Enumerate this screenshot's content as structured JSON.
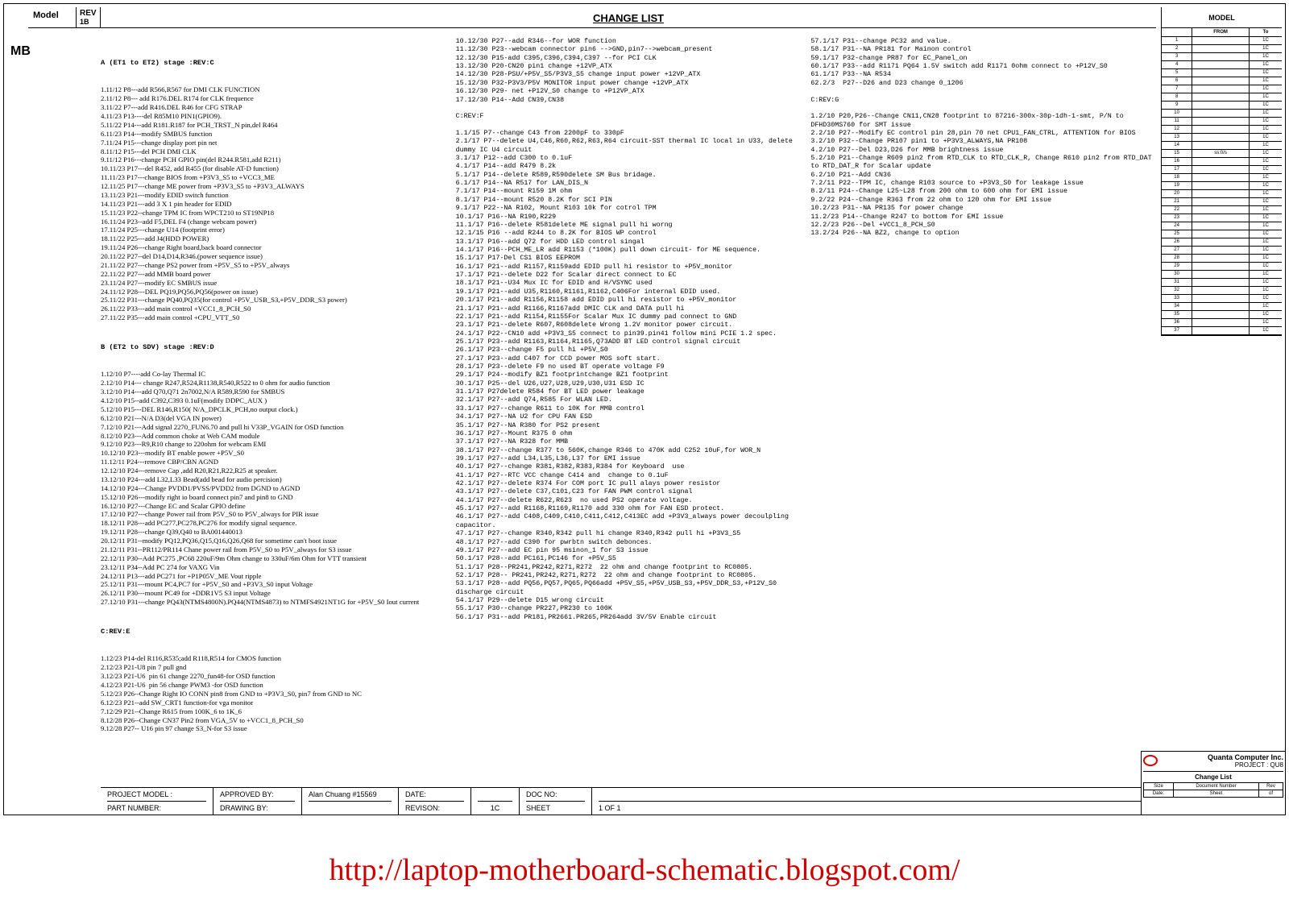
{
  "header": {
    "model_label": "Model",
    "rev_label": "REV",
    "rev_value": "1B",
    "change_list": "CHANGE LIST",
    "mb": "MB",
    "right_model": "MODEL"
  },
  "right_table": {
    "from": "FROM",
    "to": "To",
    "rows": [
      [
        "1",
        "",
        "1C"
      ],
      [
        "2",
        "",
        "1C"
      ],
      [
        "3",
        "",
        "1C"
      ],
      [
        "4",
        "",
        "1C"
      ],
      [
        "5",
        "",
        "1C"
      ],
      [
        "6",
        "",
        "1C"
      ],
      [
        "7",
        "",
        "1C"
      ],
      [
        "8",
        "",
        "1C"
      ],
      [
        "9",
        "",
        "1C"
      ],
      [
        "10",
        "",
        "1C"
      ],
      [
        "11",
        "",
        "1C"
      ],
      [
        "12",
        "",
        "1C"
      ],
      [
        "13",
        "",
        "1C"
      ],
      [
        "14",
        "",
        "1C"
      ],
      [
        "15",
        "ss:0/s",
        "1C"
      ],
      [
        "16",
        "",
        "1C"
      ],
      [
        "17",
        "",
        "1C"
      ],
      [
        "18",
        "",
        "1C"
      ],
      [
        "19",
        "",
        "1C"
      ],
      [
        "20",
        "",
        "1C"
      ],
      [
        "21",
        "",
        "1C"
      ],
      [
        "22",
        "",
        "1C"
      ],
      [
        "23",
        "",
        "1C"
      ],
      [
        "24",
        "",
        "1C"
      ],
      [
        "25",
        "",
        "1C"
      ],
      [
        "26",
        "",
        "1C"
      ],
      [
        "27",
        "",
        "1C"
      ],
      [
        "28",
        "",
        "1C"
      ],
      [
        "29",
        "",
        "1C"
      ],
      [
        "30",
        "",
        "1C"
      ],
      [
        "31",
        "",
        "1C"
      ],
      [
        "32",
        "",
        "1C"
      ],
      [
        "33",
        "",
        "1C"
      ],
      [
        "34",
        "",
        "1C"
      ],
      [
        "35",
        "",
        "1C"
      ],
      [
        "36",
        "",
        "1C"
      ],
      [
        "37",
        "",
        "1C"
      ]
    ]
  },
  "col1": {
    "heading_a": "A (ET1 to ET2) stage :REV:C",
    "lines_a": "1.11/12 P8---add R566,R567 for DMI CLK FUNCTION\n2.11/12 P8--- add R176.DEL R174 for CLK frequence\n3.11/22 P7---add R416.DEL R46 for CFG STRAP\n4.11/23 P13----del R85M10 PIN1(GPIO9).\n5.11/22 P14---add R181.R187 for PCH_TRST_N pin,del R464\n6.11/23 P14---modify SMBUS function\n7.11/24 P15---change display port pin net\n8.11/12 P15---del PCH DMI CLK\n9.11/12 P16---change PCH GPIO pin(del R244.R581,add R211)\n10.11/23 P17---del R452, add R455 (for disable AT-D function)\n11.11/23 P17---change BIOS from +P3V3_S5 to +VCC3_ME\n12.11/25 P17---change ME power from +P3V3_S5 to +P3V3_ALWAYS\n13.11/23 P21---modify EDID switch function\n14.11/23 P21---add 3 X 1 pin header for EDID\n15.11/23 P22--change TPM IC from WPCT210 to ST19NP18\n16.11/24 P23--add F5,DEL F4 (change webcam power)\n17.11/24 P25---change U14 (footprint error)\n18.11/22 P25---add J4(HDD POWER)\n19.11/24 P26---change Right board,back board connector\n20.11/22 P27--del D14,D14,R346.(power sequence issue)\n21.11/22 P27---change PS2 power from +P5V_S5 to +P5V_always\n22.11/22 P27---add MMB board power\n23.11/24 P27---modify EC SMBUS issue\n24.11/12 P28---DEL PQ19,PQ56,PQ56(power on issue)\n25.11/22 P31---change PQ40,PQ35(for control +P5V_USB_S3,+P5V_DDR_S3 power)\n26.11/22 P33---add main control +VCC1_8_PCH_S0\n27.11/22 P35---add main control +CPU_VTT_S0",
    "heading_b": "B (ET2 to SDV) stage :REV:D",
    "lines_b": "1.12/10 P7----add Co-lay Thermal IC\n2.12/10 P14--- change R247,R524,R1138,R540,R522 to 0 ohm for audio function\n3.12/10 P14---add Q70,Q71 2n7002,N/A R589,R590 for SMBUS\n4.12/10 P15--add C392,C393 0.1uF(modify DDPC_AUX )\n5.12/10 P15---DEL R146,R150( N/A_DPCLK_PCH,no output clock.)\n6.12/10 P21---N/A D3(del VGA IN power)\n7.12/10 P21---Add signal 2270_FUN6.70 and pull hi V33P_VGAIN for OSD function\n8.12/10 P23---Add common choke at Web CAM module\n9.12/10 P23---R9,R10 change to 220ohm for webcam EMI\n10.12/10 P23---modify BT enable power +P5V_S0\n11.12/11 P24---remove CBP/CBN AGND\n12.12/10 P24---remove Cap ,add R20,R21,R22,R25 at speaker.\n13.12/10 P24---add L32,L33 Bead(add bead for audio percision)\n14.12/10 P24---Change PVDD1/PVSS/PVDD2 from DGND to AGND\n15.12/10 P26---modify right io board connect pin7 and pin8 to GND\n16.12/10 P27---Change EC and Scalar GPIO define\n17.12/10 P27---change Power rail from P5V_S0 to P5V_always for PIR issue\n18.12/11 P28---add PC277,PC278,PC276 for modify signal sequence.\n19.12/11 P28---change Q39,Q40 to BA001440013\n20.12/11 P31--modify PQ12,PQ36,Q15,Q16,Q26,Q68 for sometime can't boot issue\n21.12/11 P31--PR112/PR114 Chane power rail from P5V_S0 to P5V_always for S3 issue\n22.12/11 P30--Add PC275 ,PC68 220uF/9m Ohm change to 330uF/6m Ohm for VTT transient\n23.12/11 P34--Add PC 274 for VAXG Vin\n24.12/11 P13---add PC271 for +P1P05V_ME Vout ripple\n25.12/11 P31---mount PC4,PC7 for +P5V_S0 and +P3V3_S0 input Voltage\n26.12/11 P30---mount PC49 for +DDR1V5 S3 input Voltage\n27.12/10 P31---change PQ43(NTMS4800N).PQ44(NTMS4873) to NTMFS4921NT1G for +P5V_S0 Iout current",
    "heading_c": "C:REV:E",
    "lines_c": "1.12/23 P14-del R116,R535;add R118,R514 for CMOS function\n2.12/23 P21-U8 pin 7 pull gnd\n3.12/23 P21-U6  pin 61 change 2270_fun48-for OSD function\n4.12/23 P21-U6  pin 56 change PWM3 -for OSD function\n5.12/23 P26--Change Right IO CONN pin8 from GND to +P3V3_S0, pin7 from GND to NC\n6.12/23 P21--add SW_CRT1 function-for vga monitor\n7.12/29 P21--Change R615 from 100K_6 to 1K_6\n8.12/28 P26--Change CN37 Pin2 from VGA_5V to +VCC1_8_PCH_S0\n9.12/28 P27-- U16 pin 97 change S3_N-for S3 issue"
  },
  "col2": "10.12/30 P27--add R346--for WOR function\n11.12/30 P23--webcam connector pin6 -->GND,pin7-->webcam_present\n12.12/30 P15-add C395,C396,C394,C397 --for PCI CLK\n13.12/30 P20-CN20 pin1 change +12VP_ATX\n14.12/30 P28-PSU/+P5V_S5/P3V3_S5 change input power +12VP_ATX\n15.12/30 P32-P3V3/P5V MONITOR input power change +12VP_ATX\n16.12/30 P29- net +P12V_S0 change to +P12VP_ATX\n17.12/30 P14--Add CN39,CN38\n\nC:REV:F\n\n1.1/15 P7--change C43 from 2200pF to 330pF\n2.1/17 P7--delete U4,C46,R60,R62,R63,R64 circuit-SST thermal IC local in U33, delete dummy IC U4 circuit\n3.1/17 P12--add C300 to 0.1uF\n4.1/17 P14--add R479 8.2k\n5.1/17 P14--delete R589,R590delete SM Bus bridage.\n6.1/17 P14--NA R517 for LAN_DIS_N\n7.1/17 P14--mount R159 1M ohm\n8.1/17 P14--mount R520 8.2K for SCI PIN\n9.1/17 P22--NA R102, Mount R103 10k for cotrol TPM\n10.1/17 P16--NA R190,R229\n11.1/17 P16--delete R581delete ME signal pull hi worng\n12.1/15 P16 --add R244 to 8.2K for BIOS WP control\n13.1/17 P16--add Q72 for HDD LED control singal\n14.1/17 P16--PCH_ME_LR add R1153 (*100K) pull down circuit- for ME sequence.\n15.1/17 P17-Del CS1 BIOS EEPROM\n16.1/17 P21--add R1157,R1159add EDID pull hi resistor to +P5V_monitor\n17.1/17 P21--delete D22 for Scalar direct connect to EC\n18.1/17 P21--U34 Mux IC for EDID and H/VSYNC used\n19.1/17 P21--add U35,R1160,R1161,R1162,C406For internal EDID used.\n20.1/17 P21--add R1156,R1158 add EDID pull hi resistor to +P5V_monitor\n21.1/17 P21--add R1166,R1167add DMIC CLK and DATA pull hi\n22.1/17 P21--add R1154,R1155For Scalar Mux IC dummy pad connect to GND\n23.1/17 P21--delete R607,R608delete Wrong 1.2V monitor power circuit.\n24.1/17 P22--CN10 add +P3V3_S5 connect to pin39.pin41 follow mini PCIE 1.2 spec.\n25.1/17 P23--add R1163,R1164,R1165,Q73ADD BT LED control signal circuit\n26.1/17 P23--change F5 pull hi +P5V_S0\n27.1/17 P23--add C407 for CCD power MOS soft start.\n28.1/17 P23--delete F9 no used BT operate voltage F9\n29.1/17 P24--modify BZ1 footprintchange BZ1 footprint\n30.1/17 P25--del U26,U27,U28,U29,U30,U31 ESD IC\n31.1/17 P27delete R584 for BT LED power leakage\n32.1/17 P27--add Q74,R585 For WLAN LED.\n33.1/17 P27--change R611 to 10K for MMB control\n34.1/17 P27--NA U2 for CPU FAN ESD\n35.1/17 P27--NA R380 for PS2 present\n36.1/17 P27--Mount R375 0 ohm\n37.1/17 P27--NA R328 for MMB\n38.1/17 P27--change R377 to 560K,change R346 to 470K add C252 10uF,for WOR_N\n39.1/17 P27--add L34,L35,L36,L37 for EMI issue\n40.1/17 P27--change R381,R382,R383,R384 for Keyboard  use\n41.1/17 P27--RTC VCC change C414 and  change to 0.1uF\n42.1/17 P27--delete R374 For COM port IC pull alays power resistor\n43.1/17 P27--delete C37,C101,C23 for FAN PWM control signal\n44.1/17 P27--delete R622,R623  no used PS2 operate voltage.\n45.1/17 P27--add R1168,R1169,R1170 add 330 ohm for FAN ESD protect.\n46.1/17 P27--add C408,C409,C410,C411,C412,C413EC add +P3V3_always power decoulpling capacitor.\n47.1/17 P27--change R340,R342 pull hi change R340,R342 pull hi +P3V3_S5\n48.1/17 P27--add C390 for pwrbtn switch debonces.\n49.1/17 P27--add EC pin 95 msinon_1 for S3 issue\n50.1/17 P28--add PC161,PC146 for +P5V_S5\n51.1/17 P28--PR241,PR242,R271,R272  22 ohm and change footprint to RC0805.\n52.1/17 P28-- PR241,PR242,R271,R272  22 ohm and change footprint to RC0805.\n53.1/17 P28--add PQ56,PQ57,PQ65,PQ66add +P5V_S5,+P5V_USB_S3,+P5V_DDR_S3,+P12V_S0 discharge circuit\n54.1/17 P29--delete D15 wrong circuit\n55.1/17 P30--change PR227,PR230 to 100K\n56.1/17 P31--add PR181,PR2661.PR265,PR264add 3V/5V Enable circuit",
  "col3": "57.1/17 P31--change PC32 and value.\n58.1/17 P31--NA PR181 for Mainon control\n59.1/17 P32-change PR87 for EC_Panel_on\n60.1/17 P33--add R1171 PQ64 1.5V switch add R1171 0ohm connect to +P12V_S0\n61.1/17 P33--NA R534\n62.2/3  P27--D26 and D23 change 0_1206\n\nC:REV:G\n\n1.2/10 P20,P26--Change CN11,CN28 footprint to 87216-300x-30p-1dh-1-smt, P/N to DFHD30MS760 for SMT issue\n2.2/10 P27--Modify EC control pin 28,pin 70 net CPU1_FAN_CTRL, ATTENTION for BIOS\n3.2/10 P32--Change PR107 pin1 to +P3V3_ALWAYS,NA PR108\n4.2/10 P27--Del D23,D26 for MMB brightness issue\n5.2/10 P21--Change R609 pin2 from RTD_CLK to RTD_CLK_R, Change R610 pin2 from RTD_DAT to RTD_DAT_R for Scalar update\n6.2/10 P21--Add CN36\n7.2/11 P22--TPM IC, change R103 source to +P3V3_S0 for leakage issue\n8.2/11 P24--Change L25~L28 from 200 ohm to 600 ohm for EMI issue\n9.2/22 P24--Change R363 from 22 ohm to 120 ohm for EMI issue\n10.2/23 P31--NA PR135 for power change\n11.2/23 P14--Change R247 to bottom for EMI issue\n12.2/23 P26--Del +VCC1_8_PCH_S0\n13.2/24 P26--NA BZ2, change to option",
  "bottom": {
    "project_model": "PROJECT MODEL :",
    "part_number": "PART NUMBER:",
    "approved_by": "APPROVED BY:",
    "drawing_by": "DRAWING BY:",
    "approver": "Alan Chuang #15569",
    "date": "DATE:",
    "revison": "REVISON:",
    "rev_val": "1C",
    "doc_no": "DOC NO:",
    "sheet": "SHEET",
    "sheet_val": "1 OF 1"
  },
  "title_block": {
    "company": "Quanta Computer Inc.",
    "project": "PROJECT : QU8",
    "change_list": "Change List",
    "size": "Size",
    "docnum": "Document Number",
    "rev": "Rev",
    "date_label": "Date:",
    "sheet_label": "Sheet",
    "of": "of"
  },
  "footer_url": "http://laptop-motherboard-schematic.blogspot.com/"
}
